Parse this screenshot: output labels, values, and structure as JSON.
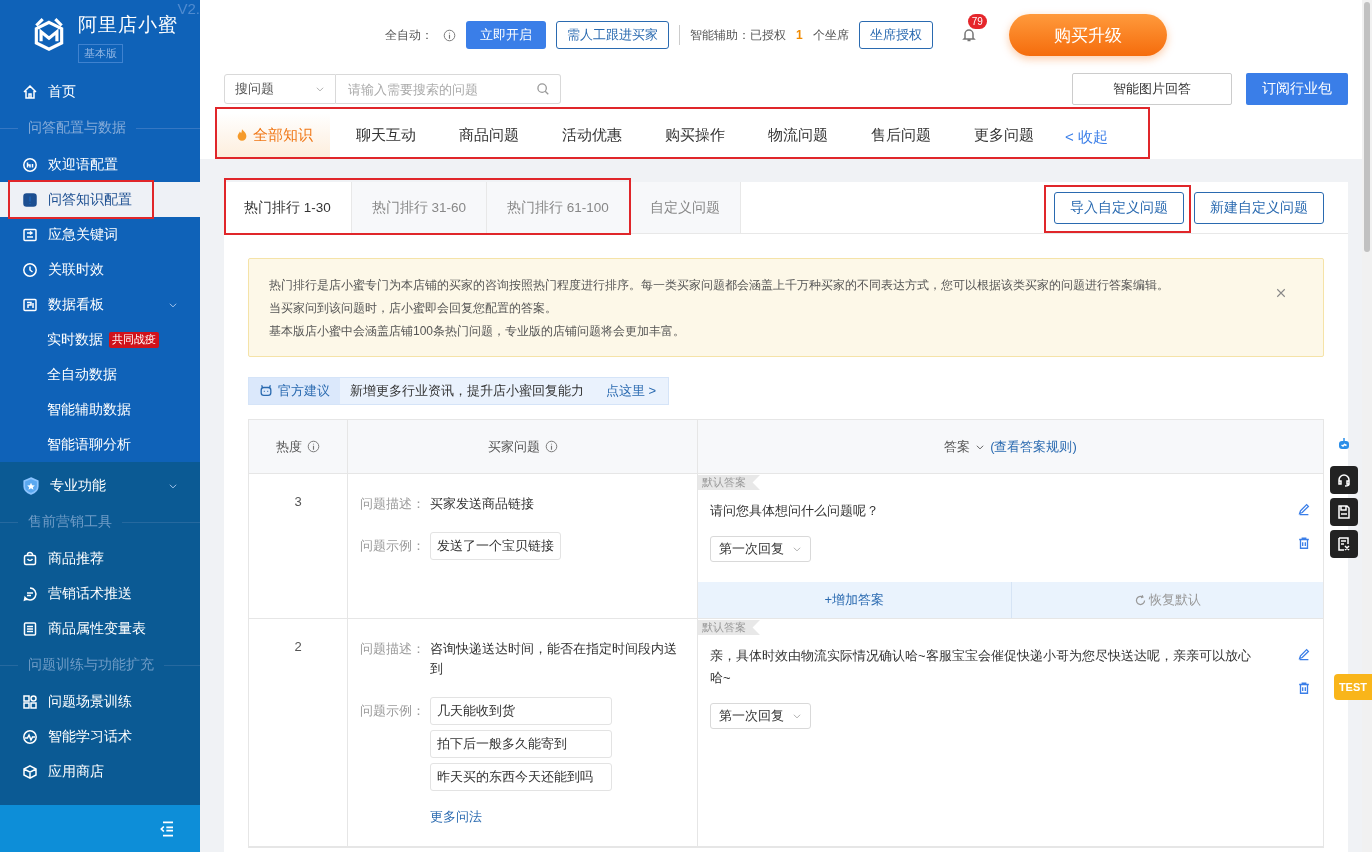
{
  "sidebar": {
    "logo": {
      "title": "阿里店小蜜",
      "edition": "基本版",
      "version": "V2."
    },
    "items": [
      {
        "kind": "item",
        "label": "首页",
        "selected": false
      },
      {
        "kind": "section",
        "label": "问答配置与数据"
      },
      {
        "kind": "item",
        "label": "欢迎语配置",
        "selected": false
      },
      {
        "kind": "item",
        "label": "问答知识配置",
        "selected": true,
        "annotated": true
      },
      {
        "kind": "item",
        "label": "应急关键词",
        "selected": false
      },
      {
        "kind": "item",
        "label": "关联时效",
        "selected": false
      },
      {
        "kind": "item",
        "label": "数据看板",
        "selected": false,
        "expanded": true,
        "children": [
          {
            "label": "实时数据",
            "badge": "共同战疫",
            "selected": false
          },
          {
            "label": "全自动数据",
            "selected": false
          },
          {
            "label": "智能辅助数据",
            "selected": false
          },
          {
            "label": "智能语聊分析",
            "selected": false
          }
        ]
      }
    ],
    "pro_group": {
      "label": "专业功能",
      "expanded": true,
      "items": [
        {
          "kind": "section",
          "label": "售前营销工具"
        },
        {
          "kind": "item",
          "label": "商品推荐",
          "selected": false
        },
        {
          "kind": "item",
          "label": "营销话术推送",
          "selected": false
        },
        {
          "kind": "item",
          "label": "商品属性变量表",
          "selected": false
        },
        {
          "kind": "section",
          "label": "问题训练与功能扩充"
        },
        {
          "kind": "item",
          "label": "问题场景训练",
          "selected": false
        },
        {
          "kind": "item",
          "label": "智能学习话术",
          "selected": false
        },
        {
          "kind": "item",
          "label": "应用商店",
          "selected": false
        }
      ]
    }
  },
  "header": {
    "auto_reply": {
      "label": "全自动：",
      "button": "立即开启"
    },
    "follow_button": "需人工跟进买家",
    "assist": {
      "label": "智能辅助：已授权",
      "count": "1",
      "unit": "个坐席",
      "button": "坐席授权"
    },
    "notifications": {
      "count": "79"
    },
    "upgrade_button": "购买升级"
  },
  "search": {
    "scope": "搜问题",
    "placeholder": "请输入需要搜索的问题"
  },
  "toolbar_buttons": [
    {
      "label": "智能图片回答",
      "kind": "secondary"
    },
    {
      "label": "订阅行业包",
      "kind": "primary"
    }
  ],
  "category_tabs": {
    "annotated": true,
    "tabs": [
      {
        "label": "全部知识",
        "selected": true
      },
      {
        "label": "聊天互动",
        "selected": false
      },
      {
        "label": "商品问题",
        "selected": false
      },
      {
        "label": "活动优惠",
        "selected": false
      },
      {
        "label": "购买操作",
        "selected": false
      },
      {
        "label": "物流问题",
        "selected": false
      },
      {
        "label": "售后问题",
        "selected": false
      },
      {
        "label": "更多问题",
        "selected": false
      }
    ],
    "collapse_link": "< 收起"
  },
  "ranking_tabs": {
    "annotated": true,
    "tabs": [
      {
        "label": "热门排行 1-30",
        "selected": true
      },
      {
        "label": "热门排行 31-60",
        "selected": false
      },
      {
        "label": "热门排行 61-100",
        "selected": false
      }
    ]
  },
  "custom_tab": {
    "label": "自定义问题",
    "selected": false
  },
  "actions": [
    {
      "label": "导入自定义问题",
      "annotated": true
    },
    {
      "label": "新建自定义问题"
    }
  ],
  "notice": {
    "lines": [
      "热门排行是店小蜜专门为本店铺的买家的咨询按照热门程度进行排序。每一类买家问题都会涵盖上千万种买家的不同表达方式，您可以根据该类买家的问题进行答案编辑。",
      "当买家问到该问题时，店小蜜即会回复您配置的答案。",
      "基本版店小蜜中会涵盖店铺100条热门问题，专业版的店铺问题将会更加丰富。"
    ]
  },
  "suggestion": {
    "tag": "官方建议",
    "text": "新增更多行业资讯，提升店小蜜回复能力",
    "link": "点这里 >"
  },
  "table": {
    "columns": [
      {
        "label": "热度",
        "kind": "info"
      },
      {
        "label": "买家问题",
        "kind": "info"
      },
      {
        "label": "答案",
        "kind": "dropdown",
        "link": "(查看答案规则)"
      }
    ],
    "rows": [
      {
        "hotness": "3",
        "description_label": "问题描述：",
        "description": "买家发送商品链接",
        "examples_label": "问题示例：",
        "examples": [
          "发送了一个宝贝链接"
        ],
        "answer_tag": "默认答案",
        "answer": "请问您具体想问什么问题呢？",
        "reply_select": "第一次回复",
        "actions": [
          "+增加答案",
          "恢复默认"
        ]
      },
      {
        "hotness": "2",
        "description_label": "问题描述：",
        "description": "咨询快递送达时间，能否在指定时间段内送到",
        "examples_label": "问题示例：",
        "examples": [
          "几天能收到货",
          "拍下后一般多久能寄到",
          "昨天买的东西今天还能到吗"
        ],
        "more_link": "更多问法",
        "answer_tag": "默认答案",
        "answer": "亲，具体时效由物流实际情况确认哈~客服宝宝会催促快递小哥为您尽快送达呢，亲亲可以放心哈~",
        "reply_select": "第一次回复"
      }
    ]
  },
  "side_tools": {
    "test_tag": "TEST"
  }
}
